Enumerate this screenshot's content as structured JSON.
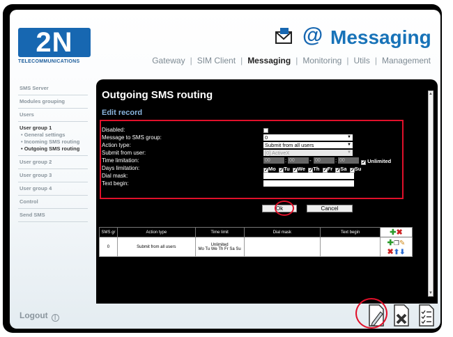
{
  "logo": {
    "text": "2N",
    "subtitle": "TELECOMMUNICATIONS"
  },
  "brand": {
    "at": "@",
    "title": "Messaging"
  },
  "topnav": [
    {
      "label": "Gateway",
      "active": false
    },
    {
      "label": "SIM Client",
      "active": false
    },
    {
      "label": "Messaging",
      "active": true
    },
    {
      "label": "Monitoring",
      "active": false
    },
    {
      "label": "Utils",
      "active": false
    },
    {
      "label": "Management",
      "active": false
    }
  ],
  "sidebar": {
    "items": [
      {
        "label": "SMS Server"
      },
      {
        "label": "Modules grouping"
      },
      {
        "label": "Users"
      },
      {
        "label": "User group 1",
        "subs": [
          "• General settings",
          "• Incoming SMS routing",
          "• Outgoing SMS routing"
        ]
      },
      {
        "label": "User group 2"
      },
      {
        "label": "User group 3"
      },
      {
        "label": "User group 4"
      },
      {
        "label": "Control"
      },
      {
        "label": "Send SMS"
      }
    ],
    "logout": "Logout"
  },
  "content": {
    "title": "Outgoing SMS routing",
    "subtitle": "Edit record",
    "form": {
      "disabled_label": "Disabled:",
      "group_label": "Message to SMS group:",
      "group_value": "0",
      "action_label": "Action type:",
      "action_value": "Submit from all users",
      "user_label": "Submit from user:",
      "user_value": "[0] ActiveX",
      "time_label": "Time limitation:",
      "time_values": [
        "00",
        "00",
        "00",
        "00"
      ],
      "unlimited_label": "Unlimited",
      "days_label": "Days limitation:",
      "days": [
        "Mo",
        "Tu",
        "We",
        "Th",
        "Fr",
        "Sa",
        "Su"
      ],
      "dial_label": "Dial mask:",
      "text_label": "Text begin:"
    },
    "buttons": {
      "ok": "Ok",
      "cancel": "Cancel"
    },
    "table": {
      "headers": [
        "SMS gr",
        "Action type",
        "Time limit",
        "Dial mask",
        "Text begin"
      ],
      "row": {
        "group": "0",
        "action": "Submit from all users",
        "time_line1": "Unlimited",
        "time_line2": "Mo Tu We Th Fr Sa Su",
        "dial": "",
        "text": ""
      }
    }
  },
  "accent": "#1767b1",
  "highlight": "#e0102a"
}
